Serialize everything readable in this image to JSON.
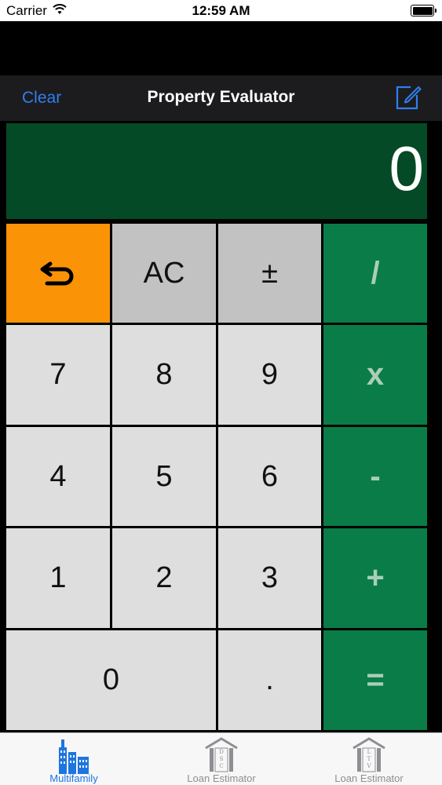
{
  "status": {
    "carrier": "Carrier",
    "time": "12:59 AM"
  },
  "nav": {
    "left_button": "Clear",
    "title": "Property Evaluator",
    "right_icon": "compose-icon"
  },
  "display": {
    "value": "0"
  },
  "keys": {
    "back": "undo-arrow-icon",
    "clear": "AC",
    "sign": "±",
    "divide": "/",
    "seven": "7",
    "eight": "8",
    "nine": "9",
    "multiply": "x",
    "four": "4",
    "five": "5",
    "six": "6",
    "minus": "-",
    "one": "1",
    "two": "2",
    "three": "3",
    "plus": "+",
    "zero": "0",
    "decimal": ".",
    "equals": "="
  },
  "tabs": [
    {
      "label": "Multifamily",
      "icon": "buildings-icon",
      "active": true
    },
    {
      "label": "Loan Estimator",
      "icon": "dsc-house-icon",
      "icon_text": "D S C",
      "active": false
    },
    {
      "label": "Loan Estimator",
      "icon": "ltv-house-icon",
      "icon_text": "L T V",
      "active": false
    }
  ],
  "colors": {
    "accent_blue": "#2f7ff0",
    "display_green": "#054a26",
    "operator_green": "#0a7c47",
    "backspace_orange": "#fa9306",
    "digit_gray": "#dedede",
    "function_gray": "#c2c2c2"
  }
}
